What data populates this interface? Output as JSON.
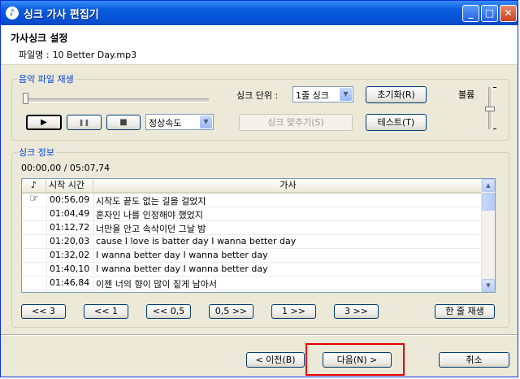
{
  "window": {
    "title": "싱크 가사 편집기",
    "app_icon": "music-note-icon",
    "controls": [
      "minimize-icon",
      "maximize-icon",
      "close-icon"
    ]
  },
  "header": {
    "heading": "가사싱크 설정",
    "file_label": "파일명 :",
    "file_name": "10 Better Day.mp3"
  },
  "playback": {
    "group_label": "음악 파일 재생",
    "position_fraction": 0.0,
    "play_icon": "▶",
    "pause_icon": "❚❚",
    "stop_icon": "■",
    "speed_select": "정상속도",
    "sync_unit_label": "싱크 단위 :",
    "sync_unit_select": "1줄 싱크",
    "reset_button": "초기화(R)",
    "volume_label": "볼륨",
    "sync_button": "싱크 맞추기(S)",
    "test_button": "테스트(T)"
  },
  "sync_info": {
    "group_label": "싱크 정보",
    "time_display": "00:00,00 / 05:07,74",
    "columns": {
      "mark": "♪",
      "time": "시작 시간",
      "lyric": "가사"
    },
    "rows": [
      {
        "mark": "☞",
        "time": "00:56,09",
        "lyric": "시작도 끝도 없는 길을 걸었지"
      },
      {
        "mark": "",
        "time": "01:04,49",
        "lyric": "혼자인 나를 인정해야 했었지"
      },
      {
        "mark": "",
        "time": "01:12,72",
        "lyric": "너만을 안고 속삭이던 그날 밤"
      },
      {
        "mark": "",
        "time": "01:20,03",
        "lyric": "cause I love is batter day I wanna better day"
      },
      {
        "mark": "",
        "time": "01:32,02",
        "lyric": "I wanna better day I wanna better day"
      },
      {
        "mark": "",
        "time": "01:40,10",
        "lyric": "I wanna better day I wanna better day"
      },
      {
        "mark": "",
        "time": "01:46,84",
        "lyric": "이젠 너의 향이 많이 짙게 남아서"
      }
    ],
    "nav_buttons": [
      "<< 3",
      "<< 1",
      "<< 0,5",
      "0,5 >>",
      "1 >>",
      "3 >>"
    ],
    "play_line_button": "한 줄 재생"
  },
  "footer": {
    "prev_button": "< 이전(B)",
    "next_button": "다음(N) >",
    "cancel_button": "취소"
  }
}
